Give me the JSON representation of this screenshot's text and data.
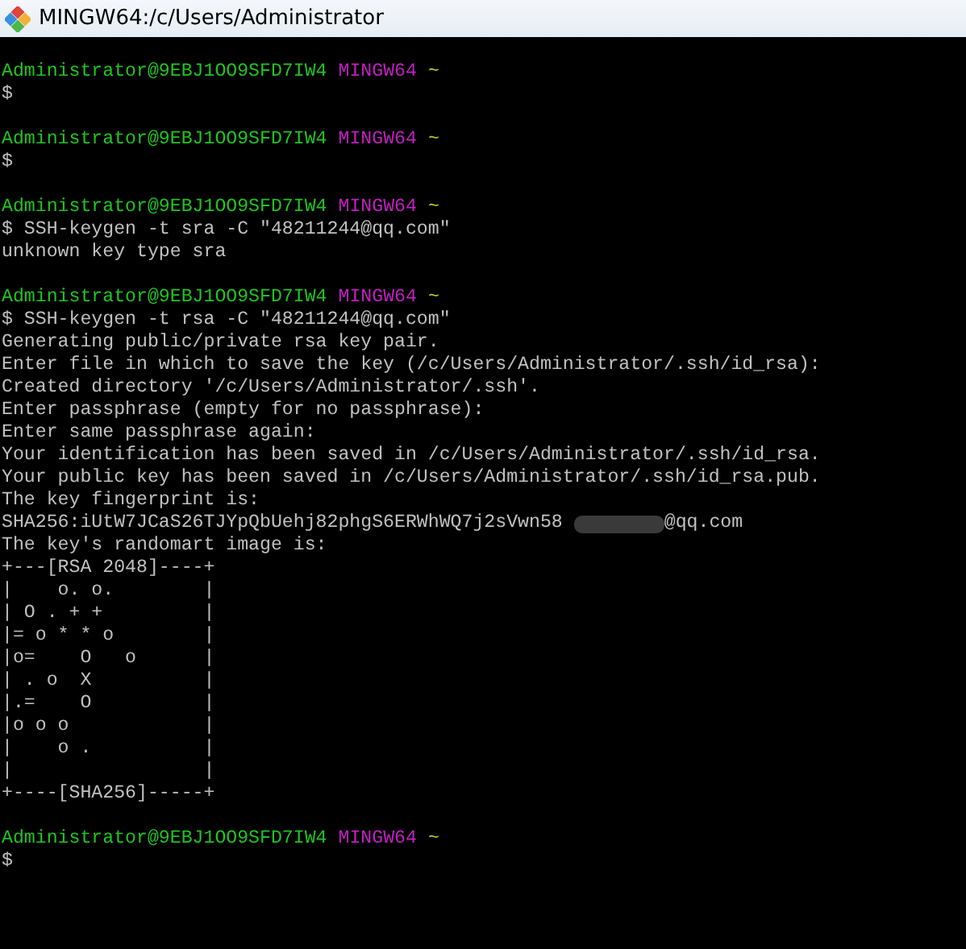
{
  "window": {
    "title": "MINGW64:/c/Users/Administrator"
  },
  "lines": [
    {
      "kind": "blank"
    },
    {
      "kind": "prompt",
      "user": "Administrator@9EBJ1OO9SFD7IW4",
      "shell": "MINGW64",
      "path": "~"
    },
    {
      "kind": "text",
      "text": "$"
    },
    {
      "kind": "blank"
    },
    {
      "kind": "prompt",
      "user": "Administrator@9EBJ1OO9SFD7IW4",
      "shell": "MINGW64",
      "path": "~"
    },
    {
      "kind": "text",
      "text": "$"
    },
    {
      "kind": "blank"
    },
    {
      "kind": "prompt",
      "user": "Administrator@9EBJ1OO9SFD7IW4",
      "shell": "MINGW64",
      "path": "~"
    },
    {
      "kind": "text",
      "text": "$ SSH-keygen -t sra -C \"48211244@qq.com\""
    },
    {
      "kind": "text",
      "text": "unknown key type sra"
    },
    {
      "kind": "blank"
    },
    {
      "kind": "prompt",
      "user": "Administrator@9EBJ1OO9SFD7IW4",
      "shell": "MINGW64",
      "path": "~"
    },
    {
      "kind": "text",
      "text": "$ SSH-keygen -t rsa -C \"48211244@qq.com\""
    },
    {
      "kind": "text",
      "text": "Generating public/private rsa key pair."
    },
    {
      "kind": "text",
      "text": "Enter file in which to save the key (/c/Users/Administrator/.ssh/id_rsa):"
    },
    {
      "kind": "text",
      "text": "Created directory '/c/Users/Administrator/.ssh'."
    },
    {
      "kind": "text",
      "text": "Enter passphrase (empty for no passphrase):"
    },
    {
      "kind": "text",
      "text": "Enter same passphrase again:"
    },
    {
      "kind": "text",
      "text": "Your identification has been saved in /c/Users/Administrator/.ssh/id_rsa."
    },
    {
      "kind": "text",
      "text": "Your public key has been saved in /c/Users/Administrator/.ssh/id_rsa.pub."
    },
    {
      "kind": "text",
      "text": "The key fingerprint is:"
    },
    {
      "kind": "fingerprint",
      "text": "SHA256:iUtW7JCaS26TJYpQbUehj82phgS6ERWhWQ7j2sVwn58",
      "suffix": "@qq.com"
    },
    {
      "kind": "text",
      "text": "The key's randomart image is:"
    },
    {
      "kind": "text",
      "text": "+---[RSA 2048]----+"
    },
    {
      "kind": "text",
      "text": "|    o. o.        |"
    },
    {
      "kind": "text",
      "text": "| O . + +         |"
    },
    {
      "kind": "text",
      "text": "|= o * * o        |"
    },
    {
      "kind": "text",
      "text": "|o=    O   o      |"
    },
    {
      "kind": "text",
      "text": "| . o  X          |"
    },
    {
      "kind": "text",
      "text": "|.=    O          |"
    },
    {
      "kind": "text",
      "text": "|o o o            |"
    },
    {
      "kind": "text",
      "text": "|    o .          |"
    },
    {
      "kind": "text",
      "text": "|                 |"
    },
    {
      "kind": "text",
      "text": "+----[SHA256]-----+"
    },
    {
      "kind": "blank"
    },
    {
      "kind": "prompt",
      "user": "Administrator@9EBJ1OO9SFD7IW4",
      "shell": "MINGW64",
      "path": "~"
    },
    {
      "kind": "text",
      "text": "$"
    }
  ]
}
